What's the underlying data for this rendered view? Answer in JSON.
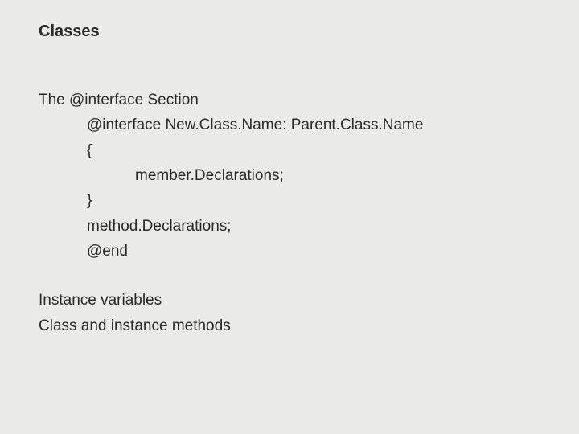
{
  "title": "Classes",
  "l0": "The @interface Section",
  "l1": "@interface New.Class.Name: Parent.Class.Name",
  "l2": "{",
  "l3": "member.Declarations;",
  "l4": "}",
  "l5": "method.Declarations;",
  "l6": "@end",
  "l7": "Instance variables",
  "l8": "Class and instance methods"
}
